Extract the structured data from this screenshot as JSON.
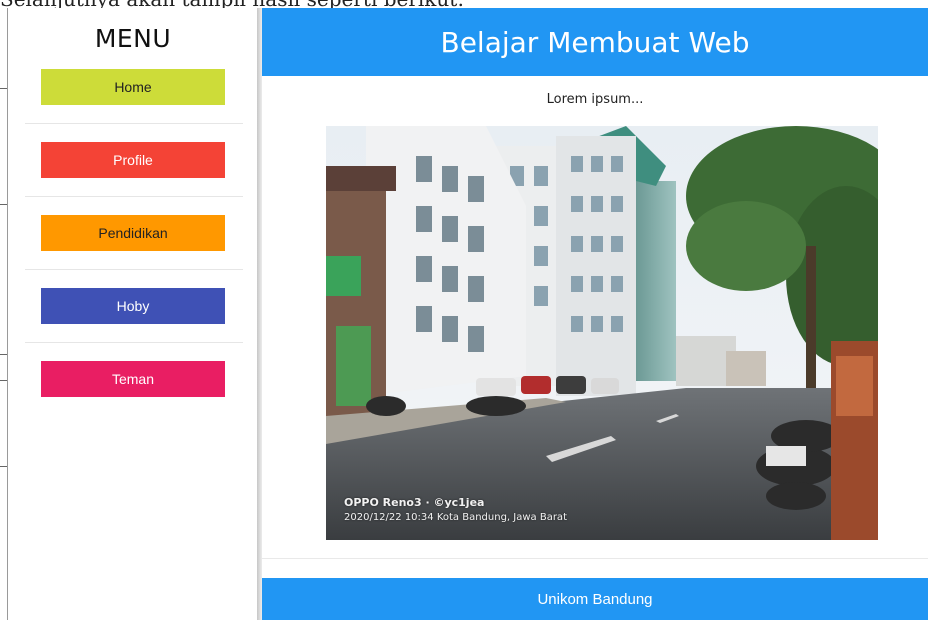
{
  "doc_text": "Selanjutnya akan tampil hasil seperti berikut:",
  "sidebar": {
    "title": "MENU",
    "items": [
      {
        "label": "Home",
        "bg": "#cddc39",
        "color": "#222222"
      },
      {
        "label": "Profile",
        "bg": "#f44336",
        "color": "#ffffff"
      },
      {
        "label": "Pendidikan",
        "bg": "#ff9800",
        "color": "#222222"
      },
      {
        "label": "Hoby",
        "bg": "#3f51b5",
        "color": "#ffffff"
      },
      {
        "label": "Teman",
        "bg": "#e91e63",
        "color": "#ffffff"
      }
    ]
  },
  "header": {
    "title": "Belajar Membuat Web",
    "bg": "#2196f3"
  },
  "main": {
    "text": "Lorem ipsum...",
    "photo_caption_line1": "OPPO Reno3 · ©yc1jea",
    "photo_caption_line2": "2020/12/22 10:34  Kota Bandung, Jawa Barat"
  },
  "footer": {
    "text": "Unikom Bandung",
    "bg": "#2196f3"
  }
}
